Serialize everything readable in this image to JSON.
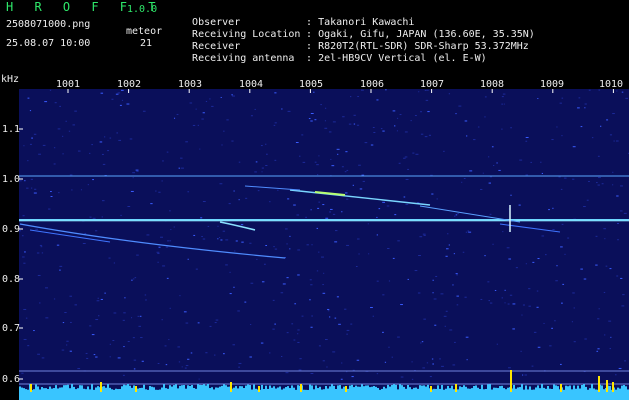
{
  "header": {
    "app_name": "H R O F F T",
    "version": "1.0.0",
    "filename": "2508071000.png",
    "datetime": "25.08.07 10:00",
    "meteor_label": "meteor",
    "meteor_count": "21"
  },
  "info": [
    {
      "label": "Observer",
      "value": ": Takanori Kawachi"
    },
    {
      "label": "Receiving Location",
      "value": ": Ogaki, Gifu, JAPAN (136.60E, 35.35N)"
    },
    {
      "label": "Receiver",
      "value": ": R820T2(RTL-SDR) SDR-Sharp 53.372MHz"
    },
    {
      "label": "Receiving antenna",
      "value": ": 2el-HB9CV Vertical (el. E-W)"
    }
  ],
  "spectrogram": {
    "unit": "kHz",
    "x_ticks": [
      "1001",
      "1002",
      "1003",
      "1004",
      "1005",
      "1006",
      "1007",
      "1008",
      "1009",
      "1010"
    ],
    "y_ticks": [
      "1.1",
      "1.0",
      "0.9",
      "0.8",
      "0.7",
      "0.6"
    ],
    "colors": {
      "background": "#0a0f5a",
      "signal": "#6fd8ff",
      "histogram": "#39c5ff",
      "spike": "#ffe600",
      "grid": "#8aa0ff"
    }
  }
}
